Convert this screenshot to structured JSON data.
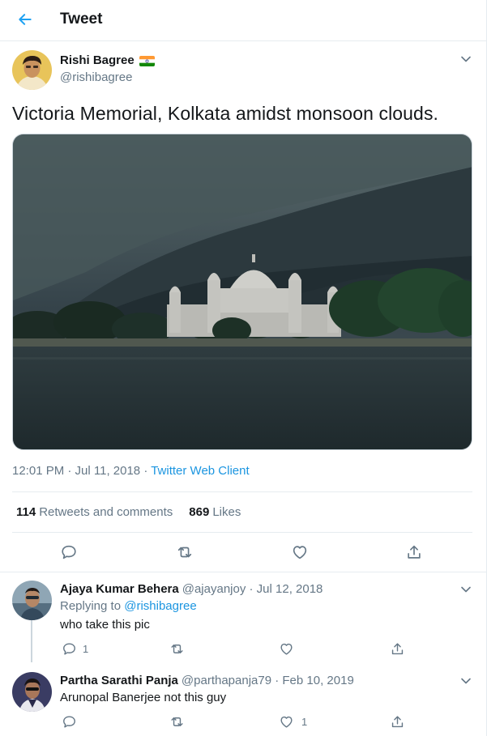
{
  "header": {
    "title": "Tweet"
  },
  "tweet": {
    "author_name": "Rishi Bagree",
    "author_handle": "@rishibagree",
    "text": "Victoria Memorial, Kolkata amidst monsoon clouds.",
    "time": "12:01 PM · Jul 11, 2018 · ",
    "client": "Twitter Web Client",
    "stats": {
      "retweets_count": "114",
      "retweets_label": "Retweets and comments",
      "likes_count": "869",
      "likes_label": "Likes"
    }
  },
  "replies": [
    {
      "name": "Ajaya Kumar Behera",
      "handle_date": "@ajayanjoy · Jul 12, 2018",
      "replying_label": "Replying to ",
      "replying_to": "@rishibagree",
      "text": "who take this pic",
      "reply_count": "1",
      "like_count": ""
    },
    {
      "name": "Partha Sarathi Panja",
      "handle_date": "@parthapanja79 · Feb 10, 2019",
      "text": "Arunopal Banerjee not this guy",
      "reply_count": "",
      "like_count": "1"
    }
  ],
  "icons": [
    "back-arrow-icon",
    "chevron-down-icon",
    "india-flag-icon",
    "reply-icon",
    "retweet-icon",
    "like-icon",
    "share-icon"
  ],
  "colors": {
    "accent": "#1da1f2",
    "link": "#1b95e0",
    "muted": "#657786",
    "border": "#e6ecf0"
  }
}
